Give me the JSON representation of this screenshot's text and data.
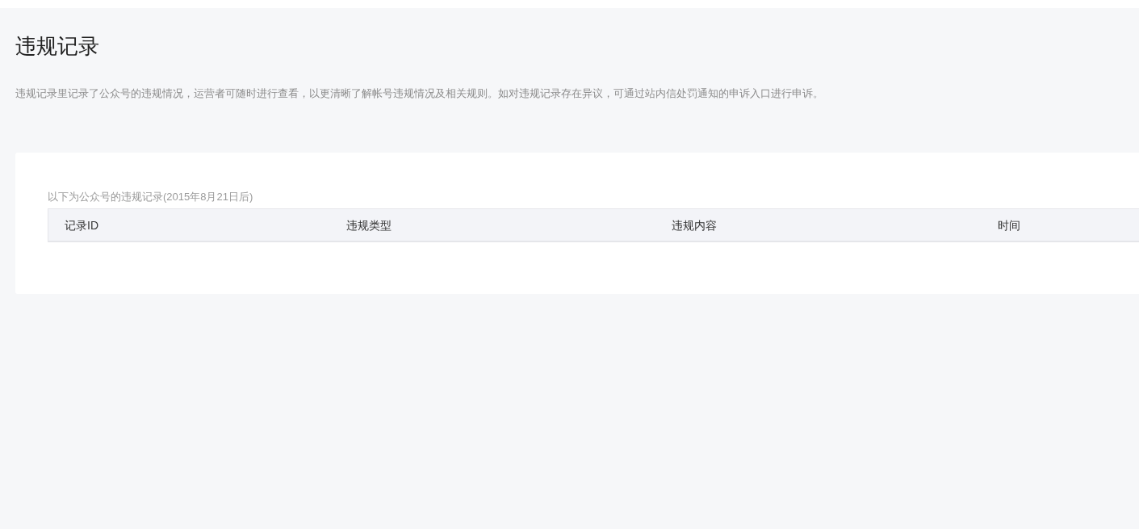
{
  "page": {
    "title": "违规记录",
    "description": "违规记录里记录了公众号的违规情况，运营者可随时进行查看，以更清晰了解帐号违规情况及相关规则。如对违规记录存在异议，可通过站内信处罚通知的申诉入口进行申诉。"
  },
  "records": {
    "caption": "以下为公众号的违规记录(2015年8月21日后)",
    "table": {
      "columns": [
        "记录ID",
        "违规类型",
        "违规内容",
        "时间"
      ]
    }
  }
}
